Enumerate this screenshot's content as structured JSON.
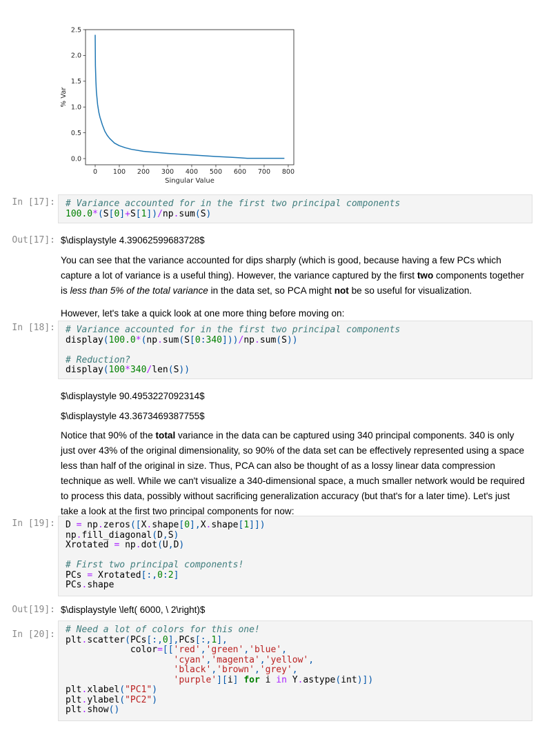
{
  "chart_data": {
    "type": "line",
    "title": "",
    "xlabel": "Singular Value",
    "ylabel": "% Var",
    "xlim": [
      -40,
      823
    ],
    "ylim": [
      -0.12,
      2.5
    ],
    "xticks": [
      0,
      100,
      200,
      300,
      400,
      500,
      600,
      700,
      800
    ],
    "xtick_labels": [
      "0",
      "100",
      "200",
      "300",
      "400",
      "500",
      "600",
      "700",
      "800"
    ],
    "yticks": [
      0.0,
      0.5,
      1.0,
      1.5,
      2.0,
      2.5
    ],
    "ytick_labels": [
      "0.0",
      "0.5",
      "1.0",
      "1.5",
      "2.0",
      "2.5"
    ],
    "grid": false,
    "series": [
      {
        "name": "% Var",
        "color": "#1f77b4",
        "x": [
          0,
          1,
          3,
          5,
          10,
          15,
          20,
          30,
          40,
          50,
          60,
          80,
          100,
          125,
          150,
          200,
          250,
          300,
          350,
          400,
          450,
          500,
          550,
          600,
          630,
          700,
          784
        ],
        "y": [
          2.4,
          1.8,
          1.5,
          1.3,
          1.05,
          0.9,
          0.8,
          0.65,
          0.53,
          0.45,
          0.39,
          0.3,
          0.25,
          0.21,
          0.18,
          0.14,
          0.12,
          0.1,
          0.085,
          0.07,
          0.055,
          0.04,
          0.028,
          0.015,
          0.005,
          0.005,
          0.005
        ]
      }
    ]
  },
  "cells": {
    "in17": {
      "prompt": "In [17]:",
      "lines": [
        [
          {
            "t": "# Variance accounted for in the first two principal components",
            "c": "com"
          }
        ],
        [
          {
            "t": "100.0",
            "c": "num"
          },
          {
            "t": "*",
            "c": "op"
          },
          {
            "t": "(",
            "c": "par"
          },
          {
            "t": "S",
            "c": ""
          },
          {
            "t": "[",
            "c": "par"
          },
          {
            "t": "0",
            "c": "num"
          },
          {
            "t": "]",
            "c": "par"
          },
          {
            "t": "+",
            "c": "op"
          },
          {
            "t": "S",
            "c": ""
          },
          {
            "t": "[",
            "c": "par"
          },
          {
            "t": "1",
            "c": "num"
          },
          {
            "t": "])",
            "c": "par"
          },
          {
            "t": "/",
            "c": "op"
          },
          {
            "t": "np",
            "c": ""
          },
          {
            "t": ".",
            "c": "op"
          },
          {
            "t": "sum",
            "c": ""
          },
          {
            "t": "(",
            "c": "par"
          },
          {
            "t": "S",
            "c": ""
          },
          {
            "t": ")",
            "c": "par"
          }
        ]
      ]
    },
    "out17": {
      "prompt": "Out[17]:",
      "text": "$\\displaystyle 4.39062599683728$"
    },
    "md1": {
      "p1": [
        {
          "t": "You can see that the variance accounted for dips sharply (which is good, because having a few PCs which capture a lot of variance is a useful thing). However, the variance captured by the first ",
          "s": ""
        },
        {
          "t": "two",
          "s": "b"
        },
        {
          "t": " components together is ",
          "s": ""
        },
        {
          "t": "less than 5% of the total variance",
          "s": "i"
        },
        {
          "t": " in the data set, so PCA might ",
          "s": ""
        },
        {
          "t": "not",
          "s": "b"
        },
        {
          "t": " be so useful for visualization.",
          "s": ""
        }
      ],
      "p2": "However, let's take a quick look at one more thing before moving on:"
    },
    "in18": {
      "prompt": "In [18]:",
      "lines": [
        [
          {
            "t": "# Variance accounted for in the first two principal components",
            "c": "com"
          }
        ],
        [
          {
            "t": "display",
            "c": ""
          },
          {
            "t": "(",
            "c": "par"
          },
          {
            "t": "100.0",
            "c": "num"
          },
          {
            "t": "*",
            "c": "op"
          },
          {
            "t": "(",
            "c": "par"
          },
          {
            "t": "np",
            "c": ""
          },
          {
            "t": ".",
            "c": "op"
          },
          {
            "t": "sum",
            "c": ""
          },
          {
            "t": "(",
            "c": "par"
          },
          {
            "t": "S",
            "c": ""
          },
          {
            "t": "[",
            "c": "par"
          },
          {
            "t": "0",
            "c": "num"
          },
          {
            "t": ":",
            "c": "par"
          },
          {
            "t": "340",
            "c": "num"
          },
          {
            "t": "]))",
            "c": "par"
          },
          {
            "t": "/",
            "c": "op"
          },
          {
            "t": "np",
            "c": ""
          },
          {
            "t": ".",
            "c": "op"
          },
          {
            "t": "sum",
            "c": ""
          },
          {
            "t": "(",
            "c": "par"
          },
          {
            "t": "S",
            "c": ""
          },
          {
            "t": "))",
            "c": "par"
          }
        ],
        [],
        [
          {
            "t": "# Reduction?",
            "c": "com"
          }
        ],
        [
          {
            "t": "display",
            "c": ""
          },
          {
            "t": "(",
            "c": "par"
          },
          {
            "t": "100",
            "c": "num"
          },
          {
            "t": "*",
            "c": "op"
          },
          {
            "t": "340",
            "c": "num"
          },
          {
            "t": "/",
            "c": "op"
          },
          {
            "t": "len",
            "c": ""
          },
          {
            "t": "(",
            "c": "par"
          },
          {
            "t": "S",
            "c": ""
          },
          {
            "t": "))",
            "c": "par"
          }
        ]
      ]
    },
    "out18": {
      "text1": "$\\displaystyle 90.4953227092314$",
      "text2": "$\\displaystyle 43.3673469387755$"
    },
    "md2": {
      "p1": [
        {
          "t": "Notice that 90% of the ",
          "s": ""
        },
        {
          "t": "total",
          "s": "b"
        },
        {
          "t": " variance in the data can be captured using 340 principal components. 340 is only just over 43% of the original dimensionality, so 90% of the data set can be effectively represented using a space less than half of the original in size. Thus, PCA can also be thought of as a lossy linear data compression technique as well. While we can't visualize a 340-dimensional space, a much smaller network would be required to process this data, possibly without sacrificing generalization accuracy (but that's for a later time). Let's just take a look at the first two principal components for now:",
          "s": ""
        }
      ]
    },
    "in19": {
      "prompt": "In [19]:",
      "lines": [
        [
          {
            "t": "D ",
            "c": ""
          },
          {
            "t": "=",
            "c": "op"
          },
          {
            "t": " np",
            "c": ""
          },
          {
            "t": ".",
            "c": "op"
          },
          {
            "t": "zeros",
            "c": ""
          },
          {
            "t": "([",
            "c": "par"
          },
          {
            "t": "X",
            "c": ""
          },
          {
            "t": ".",
            "c": "op"
          },
          {
            "t": "shape",
            "c": ""
          },
          {
            "t": "[",
            "c": "par"
          },
          {
            "t": "0",
            "c": "num"
          },
          {
            "t": "],",
            "c": "par"
          },
          {
            "t": "X",
            "c": ""
          },
          {
            "t": ".",
            "c": "op"
          },
          {
            "t": "shape",
            "c": ""
          },
          {
            "t": "[",
            "c": "par"
          },
          {
            "t": "1",
            "c": "num"
          },
          {
            "t": "]])",
            "c": "par"
          }
        ],
        [
          {
            "t": "np",
            "c": ""
          },
          {
            "t": ".",
            "c": "op"
          },
          {
            "t": "fill_diagonal",
            "c": ""
          },
          {
            "t": "(",
            "c": "par"
          },
          {
            "t": "D",
            "c": ""
          },
          {
            "t": ",",
            "c": "par"
          },
          {
            "t": "S",
            "c": ""
          },
          {
            "t": ")",
            "c": "par"
          }
        ],
        [
          {
            "t": "Xrotated ",
            "c": ""
          },
          {
            "t": "=",
            "c": "op"
          },
          {
            "t": " np",
            "c": ""
          },
          {
            "t": ".",
            "c": "op"
          },
          {
            "t": "dot",
            "c": ""
          },
          {
            "t": "(",
            "c": "par"
          },
          {
            "t": "U",
            "c": ""
          },
          {
            "t": ",",
            "c": "par"
          },
          {
            "t": "D",
            "c": ""
          },
          {
            "t": ")",
            "c": "par"
          }
        ],
        [],
        [
          {
            "t": "# First two principal components!",
            "c": "com"
          }
        ],
        [
          {
            "t": "PCs ",
            "c": ""
          },
          {
            "t": "=",
            "c": "op"
          },
          {
            "t": " Xrotated",
            "c": ""
          },
          {
            "t": "[:,",
            "c": "par"
          },
          {
            "t": "0",
            "c": "num"
          },
          {
            "t": ":",
            "c": "par"
          },
          {
            "t": "2",
            "c": "num"
          },
          {
            "t": "]",
            "c": "par"
          }
        ],
        [
          {
            "t": "PCs",
            "c": ""
          },
          {
            "t": ".",
            "c": "op"
          },
          {
            "t": "shape",
            "c": ""
          }
        ]
      ]
    },
    "out19": {
      "prompt": "Out[19]:",
      "text": "$\\displaystyle \\left( 6000, \\  2\\right)$"
    },
    "in20": {
      "prompt": "In [20]:",
      "lines": [
        [
          {
            "t": "# Need a lot of colors for this one!",
            "c": "com"
          }
        ],
        [
          {
            "t": "plt",
            "c": ""
          },
          {
            "t": ".",
            "c": "op"
          },
          {
            "t": "scatter",
            "c": ""
          },
          {
            "t": "(",
            "c": "par"
          },
          {
            "t": "PCs",
            "c": ""
          },
          {
            "t": "[:,",
            "c": "par"
          },
          {
            "t": "0",
            "c": "num"
          },
          {
            "t": "],",
            "c": "par"
          },
          {
            "t": "PCs",
            "c": ""
          },
          {
            "t": "[:,",
            "c": "par"
          },
          {
            "t": "1",
            "c": "num"
          },
          {
            "t": "],",
            "c": "par"
          }
        ],
        [
          {
            "t": "            color",
            "c": ""
          },
          {
            "t": "=",
            "c": "op"
          },
          {
            "t": "[[",
            "c": "par"
          },
          {
            "t": "'red'",
            "c": "str"
          },
          {
            "t": ",",
            "c": "par"
          },
          {
            "t": "'green'",
            "c": "str"
          },
          {
            "t": ",",
            "c": "par"
          },
          {
            "t": "'blue'",
            "c": "str"
          },
          {
            "t": ",",
            "c": "par"
          }
        ],
        [
          {
            "t": "                    ",
            "c": ""
          },
          {
            "t": "'cyan'",
            "c": "str"
          },
          {
            "t": ",",
            "c": "par"
          },
          {
            "t": "'magenta'",
            "c": "str"
          },
          {
            "t": ",",
            "c": "par"
          },
          {
            "t": "'yellow'",
            "c": "str"
          },
          {
            "t": ",",
            "c": "par"
          }
        ],
        [
          {
            "t": "                    ",
            "c": ""
          },
          {
            "t": "'black'",
            "c": "str"
          },
          {
            "t": ",",
            "c": "par"
          },
          {
            "t": "'brown'",
            "c": "str"
          },
          {
            "t": ",",
            "c": "par"
          },
          {
            "t": "'grey'",
            "c": "str"
          },
          {
            "t": ",",
            "c": "par"
          }
        ],
        [
          {
            "t": "                    ",
            "c": ""
          },
          {
            "t": "'purple'",
            "c": "str"
          },
          {
            "t": "][",
            "c": "par"
          },
          {
            "t": "i",
            "c": ""
          },
          {
            "t": "]",
            "c": "par"
          },
          {
            "t": " ",
            "c": ""
          },
          {
            "t": "for",
            "c": "kw"
          },
          {
            "t": " i ",
            "c": ""
          },
          {
            "t": "in",
            "c": "op"
          },
          {
            "t": " Y",
            "c": ""
          },
          {
            "t": ".",
            "c": "op"
          },
          {
            "t": "astype",
            "c": ""
          },
          {
            "t": "(",
            "c": "par"
          },
          {
            "t": "int",
            "c": ""
          },
          {
            "t": ")])",
            "c": "par"
          }
        ],
        [
          {
            "t": "plt",
            "c": ""
          },
          {
            "t": ".",
            "c": "op"
          },
          {
            "t": "xlabel",
            "c": ""
          },
          {
            "t": "(",
            "c": "par"
          },
          {
            "t": "\"PC1\"",
            "c": "str"
          },
          {
            "t": ")",
            "c": "par"
          }
        ],
        [
          {
            "t": "plt",
            "c": ""
          },
          {
            "t": ".",
            "c": "op"
          },
          {
            "t": "ylabel",
            "c": ""
          },
          {
            "t": "(",
            "c": "par"
          },
          {
            "t": "\"PC2\"",
            "c": "str"
          },
          {
            "t": ")",
            "c": "par"
          }
        ],
        [
          {
            "t": "plt",
            "c": ""
          },
          {
            "t": ".",
            "c": "op"
          },
          {
            "t": "show",
            "c": ""
          },
          {
            "t": "()",
            "c": "par"
          }
        ]
      ]
    }
  }
}
